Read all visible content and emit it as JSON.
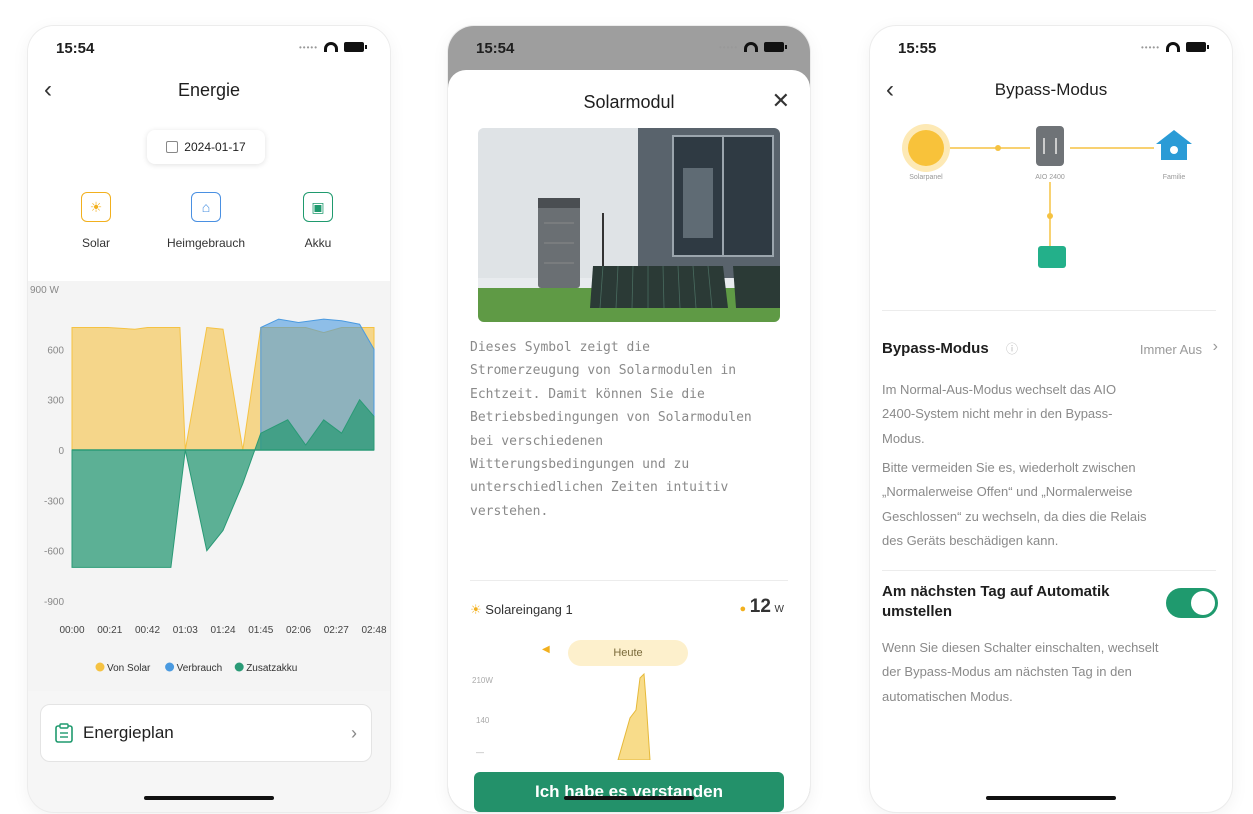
{
  "phone1": {
    "status_time": "15:54",
    "title": "Energie",
    "date": "2024-01-17",
    "modes": [
      {
        "label": "Solar",
        "icon": "solar-icon",
        "color": "#f2b01e"
      },
      {
        "label": "Heimgebrauch",
        "icon": "house-icon",
        "color": "#4a90e2"
      },
      {
        "label": "Akku",
        "icon": "battery-icon",
        "color": "#1f9a6e"
      }
    ],
    "energieplan_label": "Energieplan",
    "colors": {
      "solar": "#f5c242",
      "verbrauch": "#4a9ae0",
      "zusatzakku": "#2a9a76"
    }
  },
  "chart_data": {
    "type": "area",
    "ylabel_top": "900 W",
    "y_ticks": [
      "600",
      "300",
      "0",
      "-300",
      "-600",
      "-900"
    ],
    "ylim": [
      -900,
      900
    ],
    "x_ticks": [
      "00:00",
      "00:21",
      "00:42",
      "01:03",
      "01:24",
      "01:45",
      "02:06",
      "02:27",
      "02:48"
    ],
    "legend": [
      "Von Solar",
      "Verbrauch",
      "Zusatzakku"
    ],
    "legend_position": "bottom",
    "series": [
      {
        "name": "Von Solar",
        "x": [
          "00:00",
          "00:10",
          "00:20",
          "00:35",
          "00:42",
          "00:50",
          "01:00",
          "01:03",
          "01:15",
          "01:24",
          "01:35",
          "01:45",
          "02:00",
          "02:10",
          "02:20",
          "02:30",
          "02:40",
          "02:48"
        ],
        "values": [
          730,
          730,
          730,
          720,
          730,
          730,
          730,
          0,
          730,
          720,
          0,
          730,
          730,
          730,
          700,
          730,
          730,
          730
        ]
      },
      {
        "name": "Verbrauch",
        "x": [
          "01:45",
          "01:55",
          "02:06",
          "02:20",
          "02:30",
          "02:40",
          "02:48"
        ],
        "values": [
          730,
          780,
          760,
          780,
          770,
          750,
          600
        ]
      },
      {
        "name": "Zusatzakku",
        "x": [
          "00:00",
          "00:15",
          "00:30",
          "00:42",
          "00:55",
          "01:03",
          "01:15",
          "01:24",
          "01:35",
          "01:45",
          "02:00",
          "02:10",
          "02:20",
          "02:30",
          "02:40",
          "02:48"
        ],
        "values": [
          -700,
          -700,
          -700,
          -700,
          -700,
          0,
          -600,
          -480,
          -200,
          100,
          180,
          30,
          180,
          100,
          300,
          200
        ]
      }
    ]
  },
  "phone2": {
    "status_time": "15:54",
    "title": "Solarmodul",
    "description_lines": [
      "Dieses Symbol zeigt die",
      "Stromerzeugung von Solarmodulen in",
      "Echtzeit. Damit können Sie die",
      "Betriebsbedingungen von Solarmodulen",
      "bei verschiedenen",
      "Witterungsbedingungen und zu",
      "unterschiedlichen Zeiten intuitiv",
      "verstehen."
    ],
    "solar_input_label": "Solareingang 1",
    "solar_input_value": "12",
    "solar_input_unit": "W",
    "day_pill": "Heute",
    "mini_y_ticks": [
      "210W",
      "140",
      "—"
    ],
    "button_label": "Ich habe es verstanden"
  },
  "phone3": {
    "status_time": "15:55",
    "title": "Bypass-Modus",
    "flow_labels": [
      "Solarpanel",
      "AIO 2400",
      "Familie"
    ],
    "bypass_label": "Bypass-Modus",
    "bypass_value": "Immer Aus",
    "para1_lines": [
      "Im Normal-Aus-Modus wechselt das AIO",
      "2400-System nicht mehr in den Bypass-",
      "Modus."
    ],
    "para2_lines": [
      "Bitte vermeiden Sie es, wiederholt zwischen",
      "„Normalerweise Offen“ und „Normalerweise",
      "Geschlossen“ zu wechseln, da dies die Relais",
      "des Geräts beschädigen kann."
    ],
    "auto_title_lines": [
      "Am nächsten Tag auf Automatik",
      "umstellen"
    ],
    "auto_desc_lines": [
      "Wenn Sie diesen Schalter einschalten, wechselt",
      "der Bypass-Modus am nächsten Tag in den",
      "automatischen Modus."
    ],
    "toggle_on": true
  }
}
